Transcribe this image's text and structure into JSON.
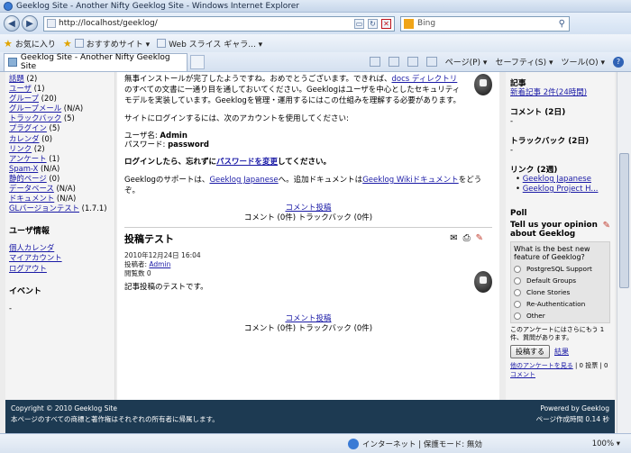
{
  "window": {
    "title": "Geeklog Site - Another Nifty Geeklog Site - Windows Internet Explorer"
  },
  "nav": {
    "address": "http://localhost/geeklog/",
    "search_text": "Bing"
  },
  "favorites": {
    "fav_label": "お気に入り",
    "item1": "おすすめサイト ▾",
    "item2": "Web スライス ギャラ... ▾"
  },
  "tab": {
    "title": "Geeklog Site - Another Nifty Geeklog Site"
  },
  "commandbar": {
    "page": "ページ(P) ▾",
    "safety": "セーフティ(S) ▾",
    "tools": "ツール(O) ▾"
  },
  "left": {
    "topics": [
      {
        "name": "話題",
        "count": "(2)"
      },
      {
        "name": "ユーザ",
        "count": "(1)"
      },
      {
        "name": "グループ",
        "count": "(20)"
      },
      {
        "name": "グループメール",
        "count": "(N/A)"
      },
      {
        "name": "トラックバック",
        "count": "(5)"
      },
      {
        "name": "プラグイン",
        "count": "(5)"
      },
      {
        "name": "カレンダ",
        "count": "(0)"
      },
      {
        "name": "リンク",
        "count": "(2)"
      },
      {
        "name": "アンケート",
        "count": "(1)"
      },
      {
        "name": "Spam-X",
        "count": "(N/A)"
      },
      {
        "name": "静的ページ",
        "count": "(0)"
      },
      {
        "name": "データベース",
        "count": "(N/A)"
      },
      {
        "name": "ドキュメント",
        "count": "(N/A)"
      },
      {
        "name": "GLバージョンテスト",
        "count": "(1.7.1)"
      }
    ],
    "user_info_title": "ユーザ情報",
    "user_links": [
      "個人カレンダ",
      "マイアカウント",
      "ログアウト"
    ],
    "events_title": "イベント",
    "events_value": "-"
  },
  "center": {
    "intro1": "無事インストールが完了したようですね。おめでとうございます。できれば、",
    "intro_link": "docs ディレクトリ",
    "intro2": "のすべての文書に一通り目を通しておいてください。Geeklogはユーザを中心としたセキュリティモデルを実装しています。Geeklogを管理・運用するにはこの仕組みを理解する必要があります。",
    "login_line": "サイトにログインするには、次のアカウントを使用してください:",
    "user_label": "ユーザ名: ",
    "user_value": "Admin",
    "pass_label": "パスワード: ",
    "pass_value": "password",
    "notice1": "ログインしたら、忘れずに",
    "notice_link": "パスワードを変更",
    "notice2": "してください。",
    "support1": "Geeklogのサポートは、",
    "support_link1": "Geeklog Japanese",
    "support2": "へ。追加ドキュメントは",
    "support_link2": "Geeklog Wikiドキュメント",
    "support3": "をどうぞ。",
    "comment_post": "コメント投稿",
    "comment_counts": "コメント (0件) トラックバック (0件)",
    "story2_title": "投稿テスト",
    "story2_date": "2010年12月24日 16:04",
    "story2_author_label": "投稿者: ",
    "story2_author": "Admin",
    "story2_views": "閲覧数 0",
    "story2_body": "記事投稿のテストです。",
    "comment_post2": "コメント投稿",
    "comment_counts2": "コメント (0件) トラックバック (0件)"
  },
  "right": {
    "articles_title": "記事",
    "articles_link": "新着記事 2件(24時間)",
    "comments_title": "コメント (2日)",
    "comments_value": "-",
    "trackback_title": "トラックバック (2日)",
    "trackback_value": "-",
    "links_title": "リンク (2週)",
    "links": [
      "Geeklog Japanese",
      "Geeklog Project H..."
    ],
    "poll_title": "Poll",
    "poll_heading": "Tell us your opinion about Geeklog",
    "poll_question": "What is the best new feature of Geeklog?",
    "poll_options": [
      "PostgreSQL Support",
      "Default Groups",
      "Clone Stories",
      "Re-Authentication",
      "Other"
    ],
    "poll_note": "このアンケートにはさらにもう 1 件、質問があります。",
    "vote_button": "投稿する",
    "results_link": "結果",
    "other_polls": "他のアンケートを見る",
    "votes": " | 0 投票 | 0",
    "comments_link": "コメント"
  },
  "footer": {
    "copyright": "Copyright © 2010 Geeklog Site",
    "rights": "本ページのすべての商標と著作権はそれぞれの所有者に帰属します。",
    "powered": "Powered by Geeklog",
    "timing": "ページ作成時間 0.14 秒"
  },
  "status": {
    "zone": "インターネット | 保護モード: 無効",
    "zoom": "100% ▾"
  }
}
